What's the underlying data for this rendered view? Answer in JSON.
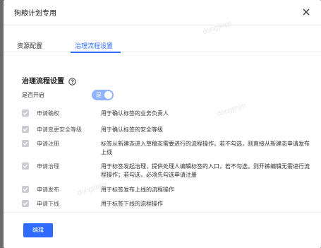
{
  "dialog": {
    "title": "狗粮计划专用"
  },
  "tabs": [
    {
      "label": "资源配置",
      "active": false
    },
    {
      "label": "治理流程设置",
      "active": true
    }
  ],
  "section": {
    "title": "治理流程设置",
    "help_icon": "question-circle-icon"
  },
  "enable": {
    "label": "是否开启",
    "switch_text": "是",
    "on": true
  },
  "rows": [
    {
      "label": "申请确权",
      "desc": "用于确认标签的业务负责人",
      "checked": true,
      "disabled": true
    },
    {
      "label": "申请变更安全等级",
      "desc": "用于确认标签的安全等级",
      "checked": true,
      "disabled": true
    },
    {
      "label": "申请注册",
      "desc": "标签从新建态进入草稿态需要进行的流程操作，若不勾选，则直接从新建态申请发布上线",
      "checked": true,
      "disabled": true
    },
    {
      "label": "申请治理",
      "desc": "用于标签发起治理，提供处理人编辑标签的入口，若不勾选，则开裤编辑无需进行流程操作；若勾选，必须先勾选申请注册",
      "checked": true,
      "disabled": true
    },
    {
      "label": "申请发布",
      "desc": "用于标签发布上线的流程操作",
      "checked": true,
      "disabled": true
    },
    {
      "label": "申请下线",
      "desc": "用于标签下线的流程操作",
      "checked": true,
      "disabled": true
    }
  ],
  "footer": {
    "edit_label": "编辑"
  },
  "watermark": "dongjinjin",
  "colors": {
    "accent": "#2f6bff",
    "switch_bg": "#8fb3ff",
    "check_disabled": "#c9cbd1"
  }
}
